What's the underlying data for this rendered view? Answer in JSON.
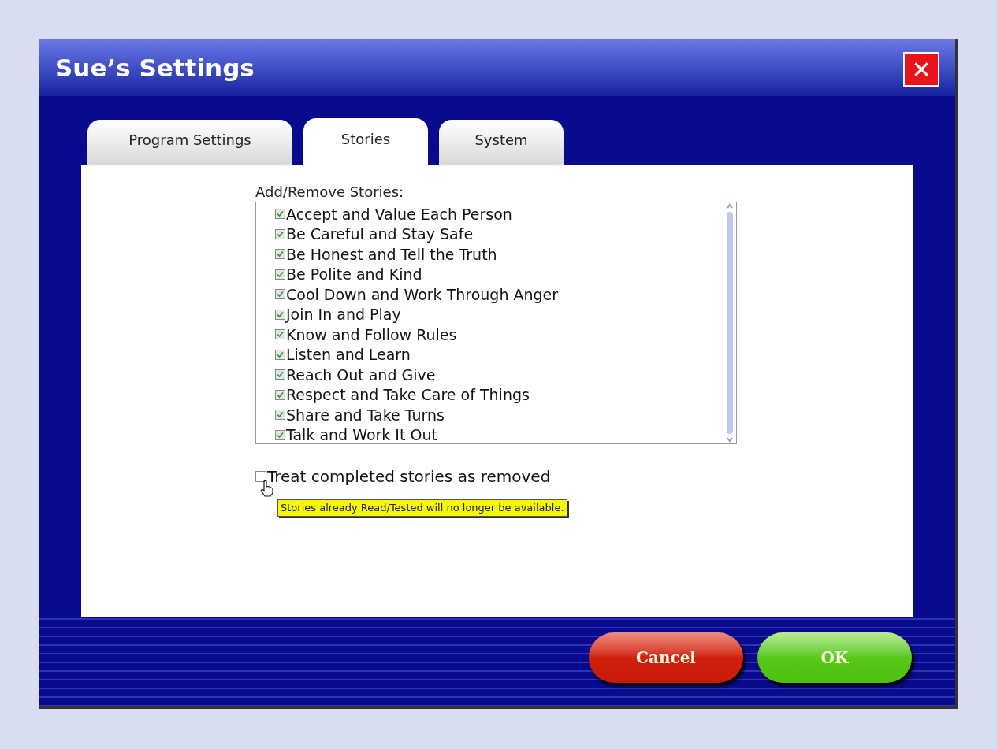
{
  "window": {
    "title": "Sue’s Settings",
    "close": "✕"
  },
  "tabs": [
    {
      "label": "Program Settings",
      "selected": false
    },
    {
      "label": "Stories",
      "selected": true
    },
    {
      "label": "System",
      "selected": false
    }
  ],
  "stories": {
    "label": "Add/Remove Stories:",
    "items": [
      {
        "label": "Accept and Value Each Person",
        "checked": true
      },
      {
        "label": "Be Careful and Stay Safe",
        "checked": true
      },
      {
        "label": "Be Honest and Tell the Truth",
        "checked": true
      },
      {
        "label": "Be Polite and Kind",
        "checked": true
      },
      {
        "label": "Cool Down and Work Through Anger",
        "checked": true
      },
      {
        "label": "Join In and Play",
        "checked": true
      },
      {
        "label": "Know and Follow Rules",
        "checked": true
      },
      {
        "label": "Listen and Learn",
        "checked": true
      },
      {
        "label": "Reach Out and Give",
        "checked": true
      },
      {
        "label": "Respect and Take Care of Things",
        "checked": true
      },
      {
        "label": "Share and Take Turns",
        "checked": true
      },
      {
        "label": "Talk and Work It Out",
        "checked": true
      }
    ]
  },
  "option": {
    "label": "Treat completed stories as removed",
    "checked": false
  },
  "tooltip": "Stories already Read/Tested will no longer be available.",
  "buttons": [
    {
      "label": "Cancel",
      "kind": "cancel"
    },
    {
      "label": "OK",
      "kind": "ok"
    }
  ]
}
